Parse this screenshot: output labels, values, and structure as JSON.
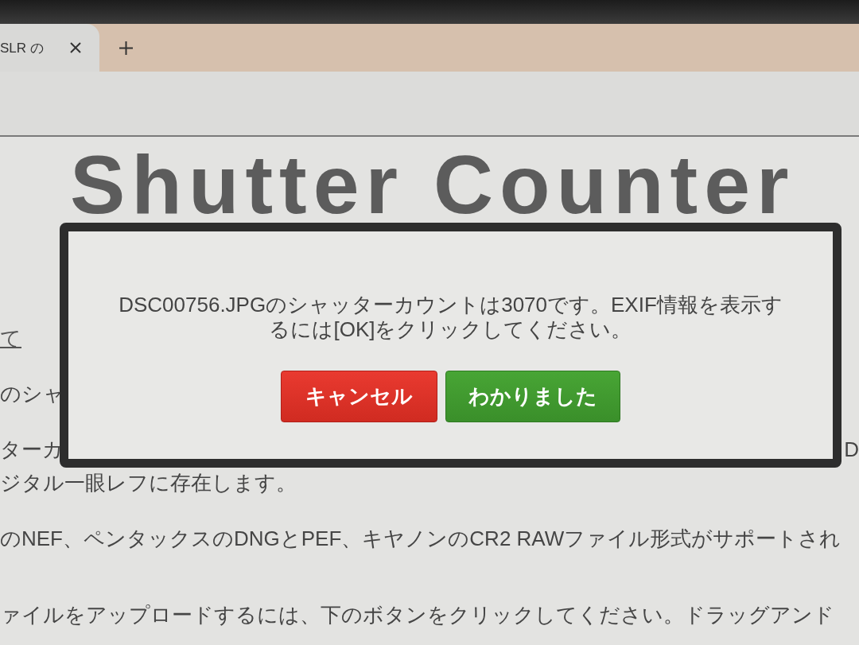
{
  "browser": {
    "tabs": [
      {
        "title": "SLR の",
        "selected": true
      }
    ]
  },
  "page": {
    "heading": "Shutter Counter",
    "paragraphs": [
      {
        "lines": [
          {
            "kind": "link",
            "text": "て"
          }
        ]
      },
      {
        "lines": [
          {
            "kind": "text",
            "text": "のシャ"
          }
        ]
      },
      {
        "lines": [
          {
            "kind": "split",
            "left": "ターカ",
            "right": "D"
          },
          {
            "kind": "text",
            "text": "ジタル一眼レフに存在します。"
          }
        ]
      },
      {
        "lines": [
          {
            "kind": "text",
            "text": "のNEF、ペンタックスのDNGとPEF、キヤノンのCR2 RAWファイル形式がサポートされ"
          }
        ]
      },
      {
        "lines": [
          {
            "kind": "text",
            "text": "ァイルをアップロードするには、下のボタンをクリックしてください。ドラッグアンド"
          }
        ]
      }
    ]
  },
  "dialog": {
    "message": "DSC00756.JPGのシャッターカウントは3070です。EXIF情報を表示するには[OK]をクリックしてください。",
    "buttons": [
      {
        "label": "キャンセル",
        "kind": "cancel"
      },
      {
        "label": "わかりました",
        "kind": "confirm"
      }
    ]
  }
}
